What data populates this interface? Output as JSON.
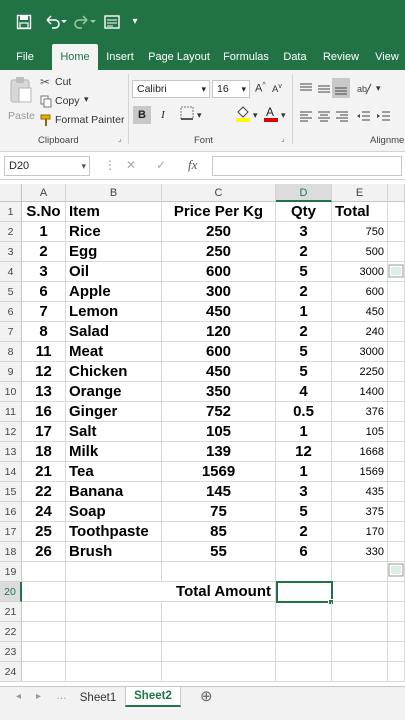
{
  "colors": {
    "brand": "#217346",
    "ribbon": "#f3f3f3",
    "header": "#f2f2f2"
  },
  "titlebar": {
    "icons": [
      "save-icon",
      "undo-icon",
      "redo-icon",
      "form-icon",
      "customize-icon"
    ]
  },
  "ribbon_tabs": [
    "File",
    "Home",
    "Insert",
    "Page Layout",
    "Formulas",
    "Data",
    "Review",
    "View"
  ],
  "active_tab": "Home",
  "clipboard": {
    "paste": "Paste",
    "cut": "Cut",
    "copy": "Copy",
    "format_painter": "Format Painter",
    "group": "Clipboard"
  },
  "font": {
    "name": "Calibri",
    "size": "16",
    "bold": "B",
    "italic": "I",
    "group": "Font"
  },
  "alignment": {
    "group": "Alignme"
  },
  "formula_bar": {
    "name_box": "D20",
    "cancel": "✕",
    "enter": "✓",
    "fx": "fx",
    "formula": ""
  },
  "columns": [
    "A",
    "B",
    "C",
    "D",
    "E"
  ],
  "selected_column": "D",
  "selected_row": "20",
  "header_row": {
    "row": "1",
    "sno": "S.No",
    "item": "Item",
    "price": "Price Per Kg",
    "qty": "Qty",
    "total": "Total"
  },
  "rows": [
    {
      "row": "2",
      "sno": "1",
      "item": "Rice",
      "price": "250",
      "qty": "3",
      "total": "750"
    },
    {
      "row": "3",
      "sno": "2",
      "item": "Egg",
      "price": "250",
      "qty": "2",
      "total": "500"
    },
    {
      "row": "4",
      "sno": "3",
      "item": "Oil",
      "price": "600",
      "qty": "5",
      "total": "3000"
    },
    {
      "row": "5",
      "sno": "6",
      "item": "Apple",
      "price": "300",
      "qty": "2",
      "total": "600"
    },
    {
      "row": "6",
      "sno": "7",
      "item": "Lemon",
      "price": "450",
      "qty": "1",
      "total": "450"
    },
    {
      "row": "7",
      "sno": "8",
      "item": "Salad",
      "price": "120",
      "qty": "2",
      "total": "240"
    },
    {
      "row": "8",
      "sno": "11",
      "item": "Meat",
      "price": "600",
      "qty": "5",
      "total": "3000"
    },
    {
      "row": "9",
      "sno": "12",
      "item": "Chicken",
      "price": "450",
      "qty": "5",
      "total": "2250"
    },
    {
      "row": "10",
      "sno": "13",
      "item": "Orange",
      "price": "350",
      "qty": "4",
      "total": "1400"
    },
    {
      "row": "11",
      "sno": "16",
      "item": "Ginger",
      "price": "752",
      "qty": "0.5",
      "total": "376"
    },
    {
      "row": "12",
      "sno": "17",
      "item": "Salt",
      "price": "105",
      "qty": "1",
      "total": "105"
    },
    {
      "row": "13",
      "sno": "18",
      "item": "Milk",
      "price": "139",
      "qty": "12",
      "total": "1668"
    },
    {
      "row": "14",
      "sno": "21",
      "item": "Tea",
      "price": "1569",
      "qty": "1",
      "total": "1569"
    },
    {
      "row": "15",
      "sno": "22",
      "item": "Banana",
      "price": "145",
      "qty": "3",
      "total": "435"
    },
    {
      "row": "16",
      "sno": "24",
      "item": "Soap",
      "price": "75",
      "qty": "5",
      "total": "375"
    },
    {
      "row": "17",
      "sno": "25",
      "item": "Toothpaste",
      "price": "85",
      "qty": "2",
      "total": "170"
    },
    {
      "row": "18",
      "sno": "26",
      "item": "Brush",
      "price": "55",
      "qty": "6",
      "total": "330"
    }
  ],
  "empty_rows": [
    "19",
    "21",
    "22",
    "23",
    "24"
  ],
  "total_row": {
    "row": "20",
    "label": "Total Amount",
    "value": ""
  },
  "sheets": [
    "Sheet1",
    "Sheet2"
  ],
  "active_sheet": "Sheet2",
  "add_sheet": "⊕"
}
